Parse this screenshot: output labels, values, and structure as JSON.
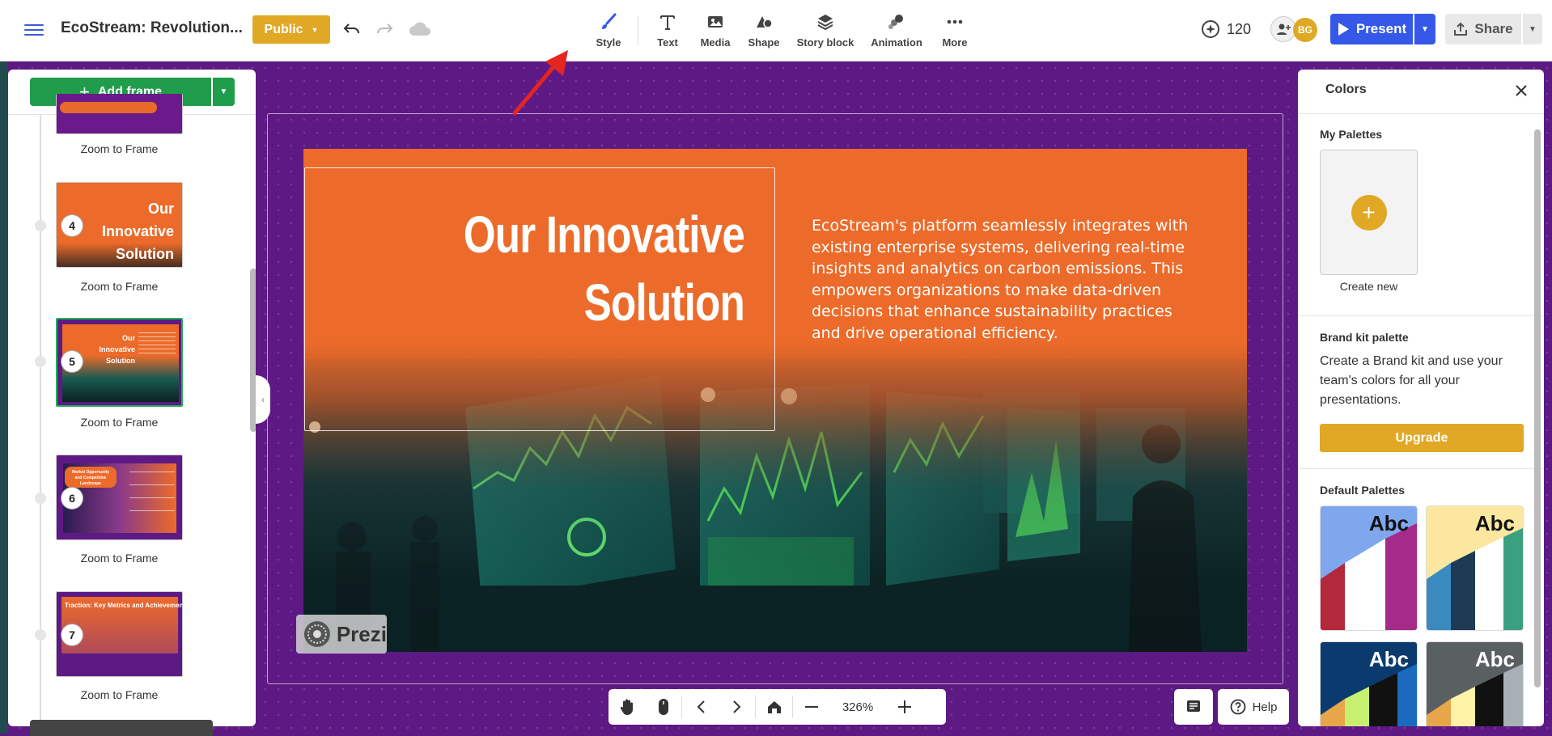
{
  "topbar": {
    "title": "EcoStream: Revolution...",
    "public_label": "Public",
    "tools": [
      {
        "label": "Style",
        "icon": "brush-icon"
      },
      {
        "label": "Text",
        "icon": "text-icon"
      },
      {
        "label": "Media",
        "icon": "image-icon"
      },
      {
        "label": "Shape",
        "icon": "shape-icon"
      },
      {
        "label": "Story block",
        "icon": "layers-icon"
      },
      {
        "label": "Animation",
        "icon": "animation-icon"
      },
      {
        "label": "More",
        "icon": "more-icon"
      }
    ],
    "credits": "120",
    "avatar_initials": "BG",
    "present_label": "Present",
    "share_label": "Share"
  },
  "left_panel": {
    "add_frame_label": "Add frame",
    "frames": [
      {
        "number": "",
        "zoom_label": "Zoom to Frame",
        "thumb_title": ""
      },
      {
        "number": "4",
        "zoom_label": "Zoom to Frame",
        "thumb_title": "Our Innovative Solution"
      },
      {
        "number": "5",
        "zoom_label": "Zoom to Frame",
        "thumb_title": "Our Innovative Solution"
      },
      {
        "number": "6",
        "zoom_label": "Zoom to Frame",
        "thumb_title": "Market Opportunity and Competitive Landscape"
      },
      {
        "number": "7",
        "zoom_label": "Zoom to Frame",
        "thumb_title": "Traction: Key Metrics and Achievements"
      }
    ]
  },
  "slide": {
    "title_line1": "Our Innovative",
    "title_line2": "Solution",
    "body": "EcoStream's platform seamlessly integrates with existing enterprise systems, delivering real-time insights and analytics on carbon emissions. This empowers organizations to make data-driven decisions that enhance sustainability practices and drive operational efficiency.",
    "watermark": "Prezi"
  },
  "right_panel": {
    "title": "Colors",
    "my_palettes": "My Palettes",
    "create_new": "Create new",
    "brand_kit_heading": "Brand kit palette",
    "brand_kit_text": "Create a Brand kit and use your team's colors for all your presentations.",
    "upgrade_label": "Upgrade",
    "default_palettes": "Default Palettes",
    "palette_sample": "Abc"
  },
  "bottom": {
    "zoom": "326%",
    "help_label": "Help"
  },
  "colors": {
    "canvas": "#5e1a84",
    "slide_orange": "#ec6b2a",
    "accent_yellow": "#e0a824",
    "present_blue": "#3558e8",
    "add_green": "#1f9d4a"
  }
}
